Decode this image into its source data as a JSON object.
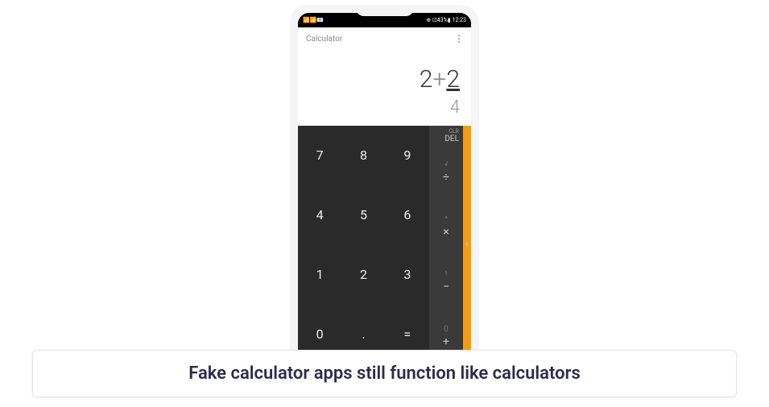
{
  "statusBar": {
    "leftIcons": "📶📶📧",
    "rightIcons": "⊕ ⊡43%▮",
    "time": "12:23"
  },
  "app": {
    "title": "Calculator",
    "menuDots": "⋮"
  },
  "display": {
    "expr_a": "2",
    "expr_op": "+",
    "expr_b": "2",
    "result": "4"
  },
  "keys": {
    "r0c0": "7",
    "r0c1": "8",
    "r0c2": "9",
    "r1c0": "4",
    "r1c1": "5",
    "r1c2": "6",
    "r2c0": "1",
    "r2c1": "2",
    "r2c2": "3",
    "r3c0": "0",
    "r3c1": ".",
    "r3c2": "="
  },
  "ops": {
    "clr": "CLR",
    "del": "DEL",
    "div_alt": "√",
    "div": "÷",
    "mul_alt": "^",
    "mul": "×",
    "sub_alt": "!",
    "sub": "−",
    "add_alt": "()",
    "add": "+"
  },
  "drawer": {
    "chevron": "‹"
  },
  "caption": "Fake calculator apps still function like calculators"
}
